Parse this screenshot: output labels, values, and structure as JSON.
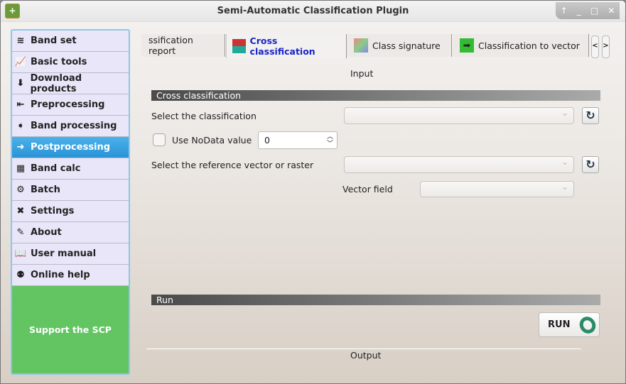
{
  "window": {
    "title": "Semi-Automatic Classification Plugin",
    "controls": [
      "↑",
      "_",
      "□",
      "✕"
    ]
  },
  "sidebar": {
    "items": [
      {
        "label": "Band set",
        "icon": "layers-icon"
      },
      {
        "label": "Basic tools",
        "icon": "chart-icon"
      },
      {
        "label": "Download products",
        "icon": "download-icon"
      },
      {
        "label": "Preprocessing",
        "icon": "import-icon"
      },
      {
        "label": "Band processing",
        "icon": "arrow-icon"
      },
      {
        "label": "Postprocessing",
        "icon": "arrow-circle-icon"
      },
      {
        "label": "Band calc",
        "icon": "calculator-icon"
      },
      {
        "label": "Batch",
        "icon": "batch-icon"
      },
      {
        "label": "Settings",
        "icon": "tools-icon"
      },
      {
        "label": "About",
        "icon": "note-icon"
      },
      {
        "label": "User manual",
        "icon": "book-icon"
      },
      {
        "label": "Online help",
        "icon": "help-icon"
      }
    ],
    "active": "Postprocessing",
    "support": "Support the SCP"
  },
  "tabs": [
    {
      "label": "ssification report"
    },
    {
      "label": "Cross classification"
    },
    {
      "label": "Class signature"
    },
    {
      "label": "Classification to vector"
    }
  ],
  "scroll": {
    "left": "<",
    "right": ">"
  },
  "main": {
    "input_label": "Input",
    "section": "Cross classification",
    "select_classification": "Select the classification",
    "use_nodata": "Use NoData value",
    "nodata_value": "0",
    "select_reference": "Select the reference vector or raster",
    "vector_field": "Vector field",
    "run_section": "Run",
    "run_button": "RUN",
    "output_label": "Output"
  },
  "colors": {
    "active_sidebar": "#2a94d6",
    "support": "#62c562",
    "active_tab_text": "#1a23c8"
  }
}
